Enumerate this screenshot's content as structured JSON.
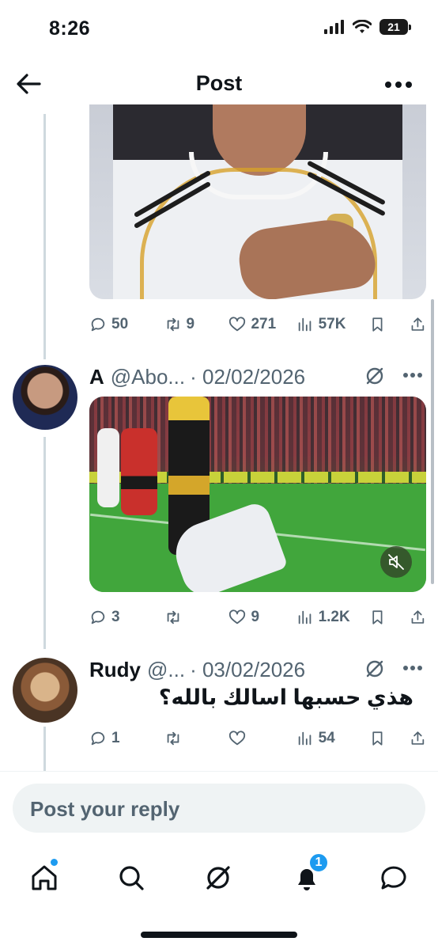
{
  "status_bar": {
    "time": "8:26",
    "battery": "21",
    "icons": [
      "signal-icon",
      "wifi-icon",
      "battery-icon"
    ]
  },
  "header": {
    "title": "Post",
    "back_icon": "back-arrow-icon",
    "more_icon": "more-icon"
  },
  "posts": [
    {
      "media": "image",
      "actions": {
        "replies": "50",
        "reposts": "9",
        "likes": "271",
        "views": "57K"
      }
    },
    {
      "author_name": "A",
      "author_handle": "@Abo...",
      "date": "· 02/02/2026",
      "media": "video",
      "actions": {
        "replies": "3",
        "reposts": "",
        "likes": "9",
        "views": "1.2K"
      }
    },
    {
      "author_name": "Rudy",
      "author_handle": "@...",
      "date": "· 03/02/2026",
      "text": "هذي حسبها اسالك بالله؟",
      "actions": {
        "replies": "1",
        "reposts": "",
        "likes": "",
        "views": "54"
      }
    }
  ],
  "reply": {
    "placeholder": "Post your reply"
  },
  "bottom_nav": {
    "items": [
      "home-icon",
      "search-icon",
      "grok-icon",
      "notifications-icon",
      "messages-icon"
    ],
    "notifications_badge": "1"
  },
  "colors": {
    "accent": "#1d9bf0",
    "muted": "#536471",
    "text": "#0f1419"
  }
}
